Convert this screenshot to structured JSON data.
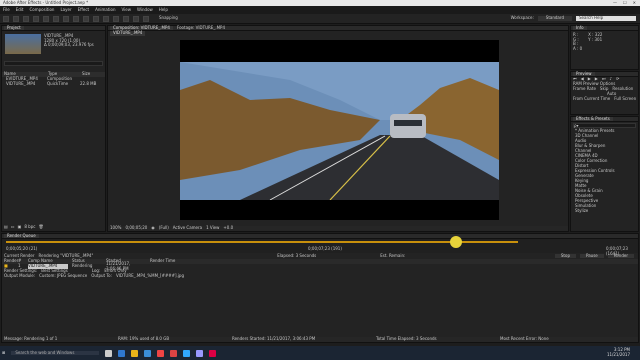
{
  "window": {
    "title": "Adobe After Effects - Untitled Project.aep *"
  },
  "menu": [
    "File",
    "Edit",
    "Composition",
    "Layer",
    "Effect",
    "Animation",
    "View",
    "Window",
    "Help"
  ],
  "toolbar": {
    "snapping": "Snapping",
    "workspace_label": "Workspace:",
    "workspace_value": "Standard",
    "search_placeholder": "Search Help"
  },
  "project": {
    "tab": "Project",
    "item_name": "VIDTURE_.MP4",
    "item_info1": "1280 x 720 (1.00)",
    "item_info2": "Δ 0;00;09;03, 23.976 fps",
    "headers": [
      "Name",
      "Type",
      "Size"
    ],
    "items": [
      {
        "name": "EVIDTURE_.MP4",
        "type": "Composition",
        "size": ""
      },
      {
        "name": "VIDTURE_.MP4",
        "type": "QuickTime",
        "size": "22.8 MB"
      }
    ],
    "bpc": "8 bpc"
  },
  "composition": {
    "tab": "Composition: VIDTURE_.MP4",
    "footage_tab": "Footage: VIDTURE_.MP4",
    "breadcrumb": "VIDTURE_.MP4",
    "zoom": "100%",
    "time": "0;00;05;20",
    "quality": "(Full)",
    "camera": "Active Camera",
    "views": "1 View",
    "offset": "+0.0"
  },
  "info": {
    "r": "R :",
    "g": "G :",
    "b": "B :",
    "a": "A : 0",
    "x": "X : 322",
    "y": "Y : 301"
  },
  "preview": {
    "tab": "Preview",
    "ram_label": "RAM Preview Options",
    "frame_rate": "Frame Rate",
    "skip": "Skip",
    "resolution": "Resolution",
    "auto": "Auto",
    "from_current": "From Current Time",
    "full_screen": "Full Screen"
  },
  "effects": {
    "tab": "Effects & Presets",
    "search_placeholder": "ρ▾",
    "items": [
      "* Animation Presets",
      "3D Channel",
      "Audio",
      "Blur & Sharpen",
      "Channel",
      "CINEMA 4D",
      "Color Correction",
      "Distort",
      "Expression Controls",
      "Generate",
      "Keying",
      "Matte",
      "Noise & Grain",
      "Obsolete",
      "Perspective",
      "Simulation",
      "Stylize"
    ]
  },
  "render": {
    "tab": "Render Queue",
    "time_left": "0;00;05;20 (21)",
    "time_mid": "0;00;07;23 (191)",
    "time_right": "0;00;07;23 (1641)",
    "current_render": "Current Render",
    "rendering_label": "Rendering \"VIDTURE_.MP4\"",
    "elapsed": "Elapsed: 3 Seconds",
    "est_remain": "Est. Remain:",
    "stop": "Stop",
    "pause": "Pause",
    "render_btn": "Render",
    "columns": [
      "Render",
      "#",
      "Comp Name",
      "Status",
      "Started",
      "Render Time"
    ],
    "item": {
      "num": "1",
      "comp": "VIDTURE_.MP4",
      "status": "Rendering",
      "started": "11/21/2017, 3:06:46 PM",
      "render_time": ""
    },
    "settings_label": "Render Settings:",
    "settings_value": "Best Settings",
    "log_label": "Log:",
    "log_value": "Errors Only",
    "output_label": "Output Module:",
    "output_value": "Custom: JPEG Sequence",
    "output_to_label": "Output To:",
    "output_to_value": "VIDTURE_.MP4_%MM_[####].jpg"
  },
  "status": {
    "message": "Message: Rendering 1 of 1",
    "ram": "RAM: 19% used of 8.0 GB",
    "renders_started": "Renders Started: 11/21/2017, 3:06:43 PM",
    "total_time": "Total Time Elapsed: 3 Seconds",
    "most_recent_error": "Most Recent Error: None"
  },
  "taskbar": {
    "search": "Search the web and Windows",
    "time": "3:12 PM",
    "date": "11/21/2017"
  },
  "colors": {
    "accent": "#e8b41a",
    "progress": "#c8900c",
    "taskbar": "#1b2533"
  }
}
